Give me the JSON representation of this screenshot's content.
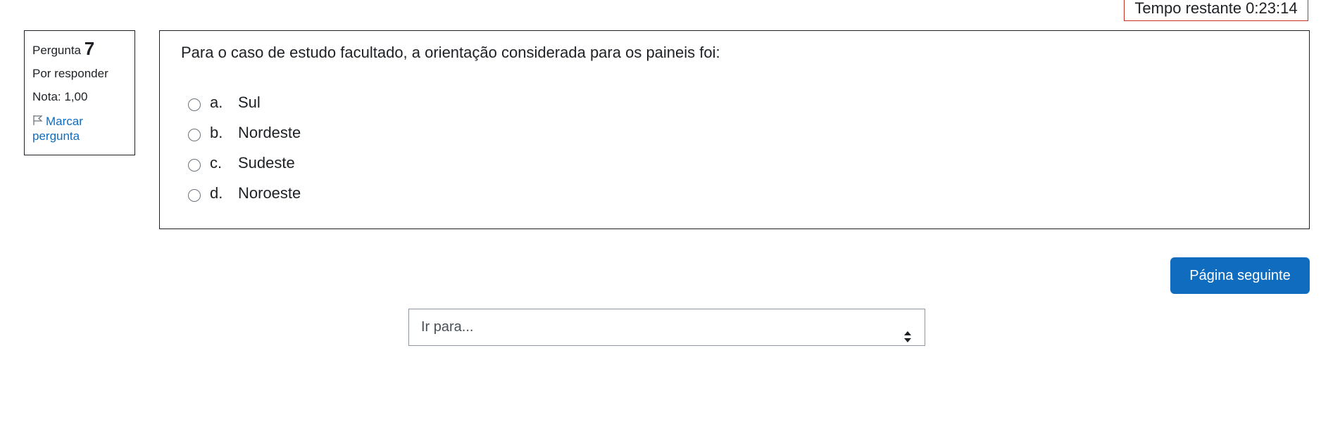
{
  "timer": {
    "text": "Tempo restante 0:23:14"
  },
  "info": {
    "question_label": "Pergunta",
    "question_number": "7",
    "state": "Por responder",
    "grade": "Nota: 1,00",
    "flag_label_1": "Marcar",
    "flag_label_2": "pergunta"
  },
  "question": {
    "text": "Para o caso de estudo facultado, a orientação considerada para os paineis foi:",
    "options": [
      {
        "letter": "a.",
        "label": "Sul"
      },
      {
        "letter": "b.",
        "label": "Nordeste"
      },
      {
        "letter": "c.",
        "label": "Sudeste"
      },
      {
        "letter": "d.",
        "label": "Noroeste"
      }
    ]
  },
  "navigation": {
    "next_label": "Página seguinte",
    "jump_placeholder": "Ir para..."
  },
  "colors": {
    "accent": "#0f6cbf",
    "timer_border": "#ca3120"
  }
}
